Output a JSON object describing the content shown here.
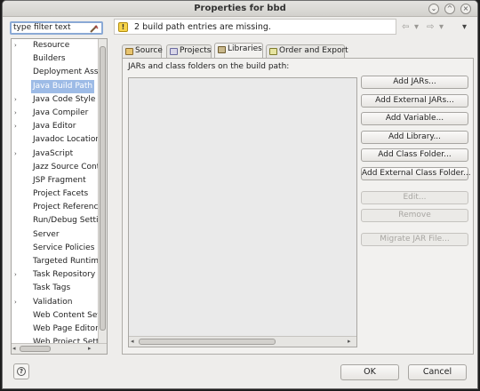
{
  "window": {
    "title": "Properties for bbd",
    "controls": [
      "⌄",
      "^",
      "×"
    ]
  },
  "filter": {
    "placeholder": "type filter text",
    "value": "type filter text"
  },
  "tree": {
    "items": [
      {
        "label": "Resource",
        "expandable": true,
        "selected": false
      },
      {
        "label": "Builders",
        "expandable": false,
        "selected": false
      },
      {
        "label": "Deployment Asse",
        "expandable": false,
        "selected": false
      },
      {
        "label": "Java Build Path",
        "expandable": false,
        "selected": true
      },
      {
        "label": "Java Code Style",
        "expandable": true,
        "selected": false
      },
      {
        "label": "Java Compiler",
        "expandable": true,
        "selected": false
      },
      {
        "label": "Java Editor",
        "expandable": true,
        "selected": false
      },
      {
        "label": "Javadoc Location",
        "expandable": false,
        "selected": false
      },
      {
        "label": "JavaScript",
        "expandable": true,
        "selected": false
      },
      {
        "label": "Jazz Source Cont",
        "expandable": false,
        "selected": false
      },
      {
        "label": "JSP Fragment",
        "expandable": false,
        "selected": false
      },
      {
        "label": "Project Facets",
        "expandable": false,
        "selected": false
      },
      {
        "label": "Project Reference",
        "expandable": false,
        "selected": false
      },
      {
        "label": "Run/Debug Settin",
        "expandable": false,
        "selected": false
      },
      {
        "label": "Server",
        "expandable": false,
        "selected": false
      },
      {
        "label": "Service Policies",
        "expandable": false,
        "selected": false
      },
      {
        "label": "Targeted Runtime",
        "expandable": false,
        "selected": false
      },
      {
        "label": "Task Repository",
        "expandable": true,
        "selected": false
      },
      {
        "label": "Task Tags",
        "expandable": false,
        "selected": false
      },
      {
        "label": "Validation",
        "expandable": true,
        "selected": false
      },
      {
        "label": "Web Content Set",
        "expandable": false,
        "selected": false
      },
      {
        "label": "Web Page Editor",
        "expandable": false,
        "selected": false
      },
      {
        "label": "Web Project Setti",
        "expandable": false,
        "selected": false
      }
    ]
  },
  "message": {
    "text": "2 build path entries are missing.",
    "icon": "warning-icon"
  },
  "tabs": [
    {
      "label": "Source",
      "active": false
    },
    {
      "label": "Projects",
      "active": false
    },
    {
      "label": "Libraries",
      "active": true
    },
    {
      "label": "Order and Export",
      "active": false
    }
  ],
  "panel": {
    "label": "JARs and class folders on the build path:"
  },
  "buttons": [
    {
      "label": "Add JARs...",
      "enabled": true
    },
    {
      "label": "Add External JARs...",
      "enabled": true
    },
    {
      "label": "Add Variable...",
      "enabled": true
    },
    {
      "label": "Add Library...",
      "enabled": true
    },
    {
      "label": "Add Class Folder...",
      "enabled": true
    },
    {
      "label": "Add External Class Folder...",
      "enabled": true
    },
    {
      "label": "Edit...",
      "enabled": false
    },
    {
      "label": "Remove",
      "enabled": false
    },
    {
      "label": "Migrate JAR File...",
      "enabled": false
    }
  ],
  "footer": {
    "help_icon": "help-icon",
    "ok": "OK",
    "cancel": "Cancel"
  },
  "colors": {
    "selection": "#9dbbe6",
    "warning": "#f7d44b"
  }
}
